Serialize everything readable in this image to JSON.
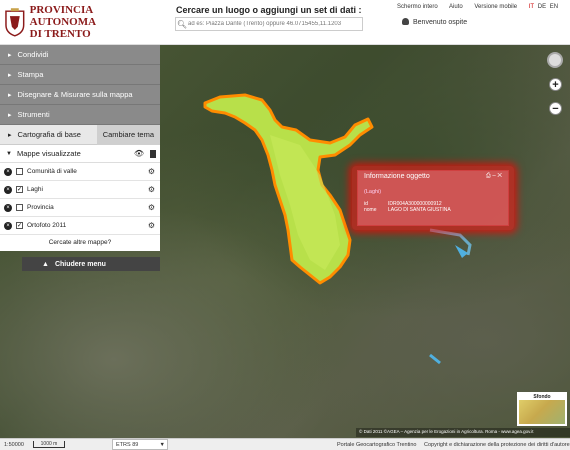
{
  "header": {
    "logo_line1": "PROVINCIA AUTONOMA",
    "logo_line2": "DI TRENTO",
    "search_title": "Cercare un luogo o aggiungi un set di dati :",
    "search_placeholder": "ad es: Piazza Dante (Trento) oppure 46.0715455,11.1203",
    "links": [
      "Schermo intero",
      "Aiuto",
      "Versione mobile"
    ],
    "lang_active": "IT",
    "lang_others": [
      "DE",
      "EN"
    ],
    "guest_label": "Benvenuto ospite"
  },
  "sidebar": {
    "items": [
      {
        "label": "Condividi"
      },
      {
        "label": "Stampa"
      },
      {
        "label": "Disegnare & Misurare sulla mappa"
      },
      {
        "label": "Strumenti"
      }
    ],
    "base_label": "Cartografia di base",
    "change_theme": "Cambiare tema",
    "maps_header": "Mappe visualizzate",
    "layers": [
      {
        "label": "Comunità di valle",
        "checked": false
      },
      {
        "label": "Laghi",
        "checked": true
      },
      {
        "label": "Provincia",
        "checked": false
      },
      {
        "label": "Ortofoto 2011",
        "checked": true
      }
    ],
    "more_maps": "Cercate altre mappe?",
    "close_menu": "Chiudere menu"
  },
  "popup": {
    "title": "Informazione oggetto",
    "subtitle": "(Laghi)",
    "rows": [
      {
        "key": "id",
        "value": "IDR004A300000000912"
      },
      {
        "key": "nome",
        "value": "LAGO DI SANTA GIUSTINA"
      }
    ]
  },
  "map": {
    "sfondo_label": "Sfondo",
    "credits": "© Dati 2011 ©AGEA – Agenzia per le Erogazioni in Agricoltura. Roma - www.agea.gov.it"
  },
  "footer": {
    "scale": "1:50000",
    "scale_bar": "1000 m",
    "projection": "ETRS 89",
    "portal": "Portale Geocartografico Trentino",
    "copyright": "Copyright e dichiarazione della protezione dei diritti d'autore"
  },
  "colors": {
    "brand": "#8b1a1a",
    "sidebar_gray": "#8a8a8a",
    "lake_fill": "#b8e04a",
    "lake_border": "#ff8c00",
    "popup_red": "#d04040"
  }
}
